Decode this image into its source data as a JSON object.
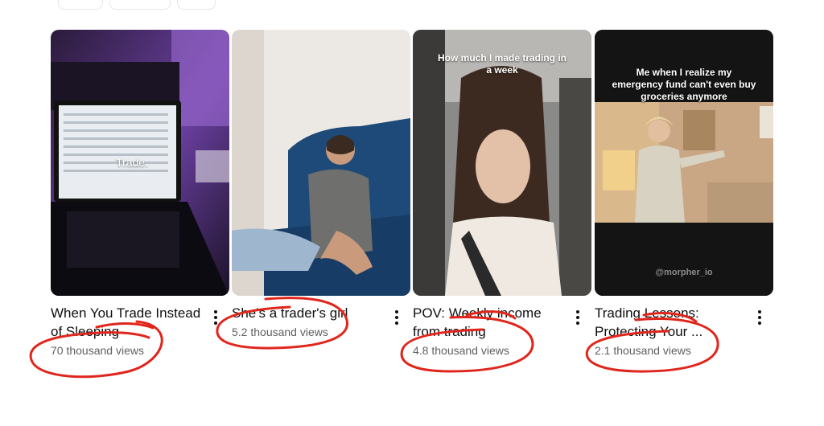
{
  "videos": [
    {
      "title": "When You Trade Instead of Sleeping",
      "views": "70 thousand views",
      "overlay": "Trade."
    },
    {
      "title": "She's a trader's girl",
      "views": "5.2 thousand views"
    },
    {
      "title": "POV: Weekly income from trading",
      "views": "4.8 thousand views",
      "overlay": "How much I made trading in a week"
    },
    {
      "title": "Trading Lessons: Protecting Your ...",
      "views": "2.1 thousand views",
      "overlay": "Me when I realize my emergency fund can't even buy groceries anymore",
      "watermark": "@morpher_io"
    }
  ],
  "colors": {
    "annotation_red": "#e0261c",
    "title_text": "#0f0f0f",
    "meta_text": "#606060"
  },
  "icons": {
    "more": "vertical-ellipsis-icon"
  }
}
